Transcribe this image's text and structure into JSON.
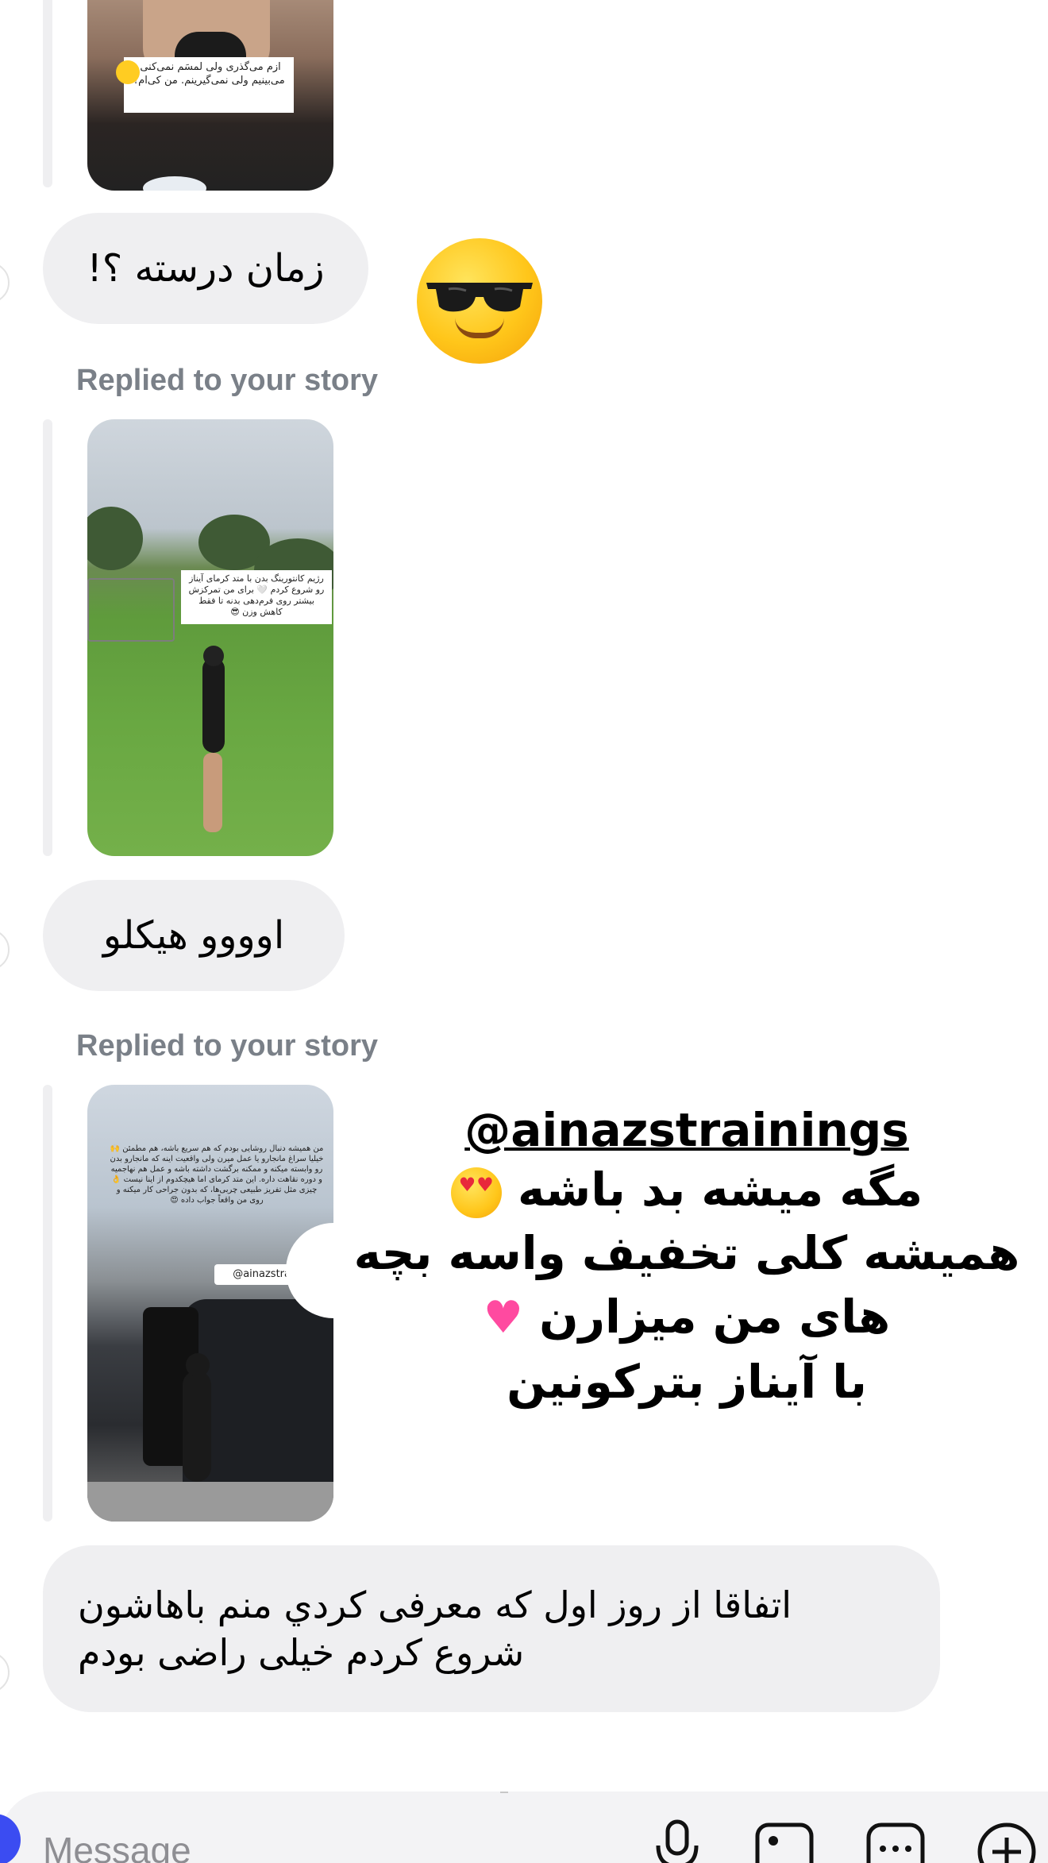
{
  "conversation": {
    "messages": [
      {
        "type": "story_reply",
        "label": "",
        "story_caption": "ازم می‌گذری ولی لمسَم نمی‌کنی.\nمی‌بینیم ولی نمی‌گیرینم. من کی‌ام؟"
      },
      {
        "type": "text",
        "text": "زمان درسته ؟!"
      },
      {
        "type": "story_reply",
        "label": "Replied to your story",
        "story_caption": "رژیم کانتورینگ بدن با متد کرمای آیناز رو شروع کردم 🤍\nبرای من تمرکزش بیشتر روی فرم‌دهی بدنه تا فقط کاهش وزن 😎"
      },
      {
        "type": "text",
        "text": "اوووو هیکلو"
      },
      {
        "type": "story_reply",
        "label": "Replied to your story",
        "story_caption": "من همیشه دنبال روشایی بودم که هم سریع باشه، هم مطمئن 🙌\nخیلیا سراغ مانجارو یا عمل میرن ولی واقعیت اینه که مانجارو بدن رو وابسته میکنه و ممکنه برگشت داشته باشه و عمل هم نهاجمیه و دوره نقاهت داره.\nاین متد کرمای اما هیچکدوم از اینا نیست 👌\nچیزی مثل تفریز طبیعی چربی‌ها، که بدون جراحی کار میکنه و روی من واقعاً جواب داده 😍",
        "story_tag": "@ainazstrainir"
      },
      {
        "type": "text",
        "lines": [
          "اتفاقا از روز اول که معرفی کردي منم باهاشون",
          "شروع کردم خیلی راضی بودم"
        ]
      }
    ]
  },
  "reaction_emoji": "smiling-face-with-sunglasses-icon",
  "promo_overlay": {
    "handle": "@ainazstrainings",
    "lines": [
      "مگه  میشه بد باشه",
      "همیشه کلی تخفیف واسه بچه",
      "های من میزارن",
      "با آیناز بترکونین"
    ],
    "emojis": [
      "😍",
      "💗"
    ]
  },
  "composer": {
    "placeholder": "Message",
    "icons": [
      "mic-icon",
      "gallery-icon",
      "sticker-icon",
      "add-icon"
    ]
  },
  "colors": {
    "bubble_bg": "#efeff1",
    "label_gray": "#7a8088",
    "composer_bg": "#f3f3f5",
    "camera_button": "#3b4cf2"
  }
}
